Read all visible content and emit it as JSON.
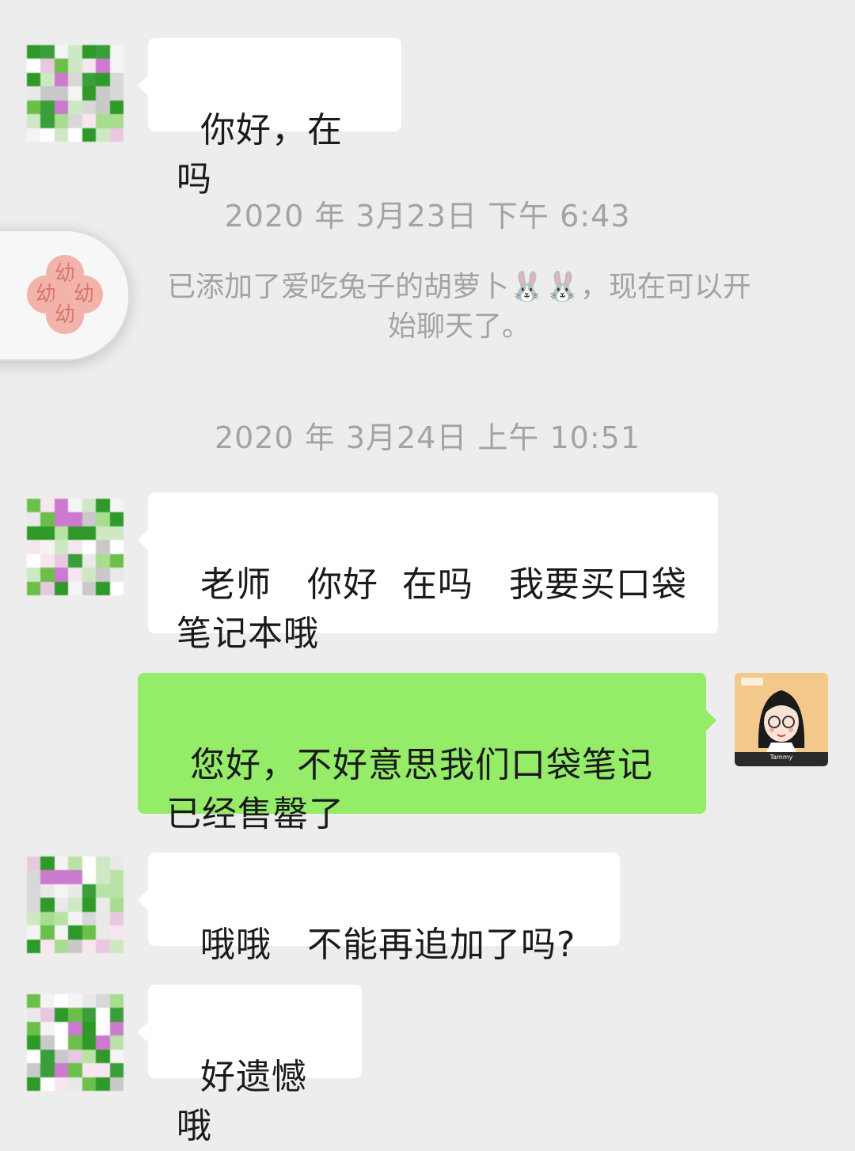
{
  "messages": [
    {
      "text": "你好，在吗"
    },
    {
      "text": "老师   你好  在吗   我要买口袋\n笔记本哦"
    },
    {
      "text": "您好，不好意思我们口袋笔记\n已经售罄了"
    },
    {
      "text": "哦哦   不能再追加了吗?"
    },
    {
      "text": "好遗憾哦"
    }
  ],
  "timestamps": [
    "2020 年 3月23日 下午 6:43",
    "2020 年 3月24日 上午 10:51"
  ],
  "system_notice": "已添加了爱吃兔子的胡萝卜🐰🐰，现在可以开\n始聊天了。",
  "floating_button": {
    "petal_text": "幼"
  },
  "my_avatar": {
    "text": "Tammy"
  },
  "colors": {
    "background": "#ededed",
    "incoming_bubble": "#ffffff",
    "outgoing_bubble": "#95ec69",
    "meta_text": "#a3a3a3"
  }
}
